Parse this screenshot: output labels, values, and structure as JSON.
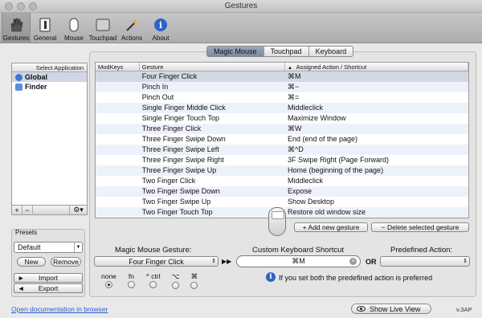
{
  "window": {
    "title": "Gestures"
  },
  "toolbar": [
    {
      "label": "Gestures",
      "icon": "hand-icon",
      "selected": true
    },
    {
      "label": "General",
      "icon": "switch-icon"
    },
    {
      "label": "Mouse",
      "icon": "mouse-icon"
    },
    {
      "label": "Touchpad",
      "icon": "touchpad-icon"
    },
    {
      "label": "Actions",
      "icon": "magic-wand-icon"
    },
    {
      "label": "About",
      "icon": "info-icon"
    }
  ],
  "apps": {
    "header": "Select Application",
    "items": [
      {
        "label": "Global",
        "selected": true
      },
      {
        "label": "Finder"
      }
    ],
    "add": "+",
    "remove": "−",
    "gear": "⚙▾"
  },
  "presets": {
    "legend": "Presets",
    "selected": "Default",
    "new_label": "New",
    "remove_label": "Remove",
    "import_label": "Import",
    "export_label": "Export"
  },
  "tabs": [
    {
      "label": "Magic Mouse",
      "selected": true
    },
    {
      "label": "Touchpad"
    },
    {
      "label": "Keyboard"
    }
  ],
  "table": {
    "headers": [
      "ModKeys",
      "Gesture",
      "Assigned Action / Shortcut"
    ],
    "sort_indicator": "▲",
    "rows": [
      {
        "mod": "",
        "gesture": "Four Finger Click",
        "action": "⌘M",
        "selected": true
      },
      {
        "mod": "",
        "gesture": "Pinch In",
        "action": "⌘−"
      },
      {
        "mod": "",
        "gesture": "Pinch Out",
        "action": "⌘="
      },
      {
        "mod": "",
        "gesture": "Single Finger Middle Click",
        "action": "Middleclick"
      },
      {
        "mod": "",
        "gesture": "Single Finger Touch Top",
        "action": "Maximize Window"
      },
      {
        "mod": "",
        "gesture": "Three Finger Click",
        "action": "⌘W"
      },
      {
        "mod": "",
        "gesture": "Three Finger Swipe Down",
        "action": "End (end of the page)"
      },
      {
        "mod": "",
        "gesture": "Three Finger Swipe Left",
        "action": "⌘^D"
      },
      {
        "mod": "",
        "gesture": "Three Finger Swipe Right",
        "action": "3F Swipe Right (Page Forward)"
      },
      {
        "mod": "",
        "gesture": "Three Finger Swipe Up",
        "action": "Home (beginning of the page)"
      },
      {
        "mod": "",
        "gesture": "Two Finger Click",
        "action": "Middleclick"
      },
      {
        "mod": "",
        "gesture": "Two Finger Swipe Down",
        "action": "Expose"
      },
      {
        "mod": "",
        "gesture": "Two Finger Swipe Up",
        "action": "Show Desktop"
      },
      {
        "mod": "",
        "gesture": "Two Finger Touch Top",
        "action": "Restore old window size"
      }
    ]
  },
  "buttons": {
    "add_gesture": "Add new gesture",
    "delete_gesture": "Delete selected gesture"
  },
  "editor": {
    "gesture_label": "Magic Mouse Gesture:",
    "gesture_value": "Four Finger Click",
    "arrows": "▶▶",
    "shortcut_label": "Custom Keyboard Shortcut",
    "shortcut_value": "⌘M",
    "or_label": "OR",
    "predefined_label": "Predefined Action:",
    "predefined_value": ""
  },
  "modifiers": [
    {
      "label": "none",
      "selected": true
    },
    {
      "label": "fn"
    },
    {
      "label": "^ ctrl"
    },
    {
      "label": "⌥"
    },
    {
      "label": "⌘"
    }
  ],
  "info_text": "If you set both the predefined action is preferred",
  "footer": {
    "doc_link": "Open documentation in browser",
    "live_view": "Show Live View",
    "version": "v.3AP"
  }
}
